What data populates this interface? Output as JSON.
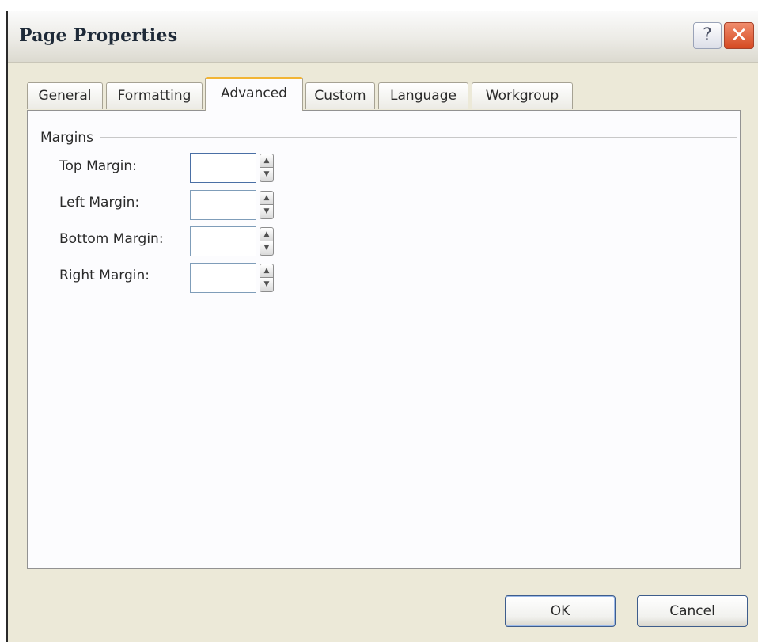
{
  "dialog": {
    "title": "Page Properties",
    "help_label": "?",
    "close_label": "✕"
  },
  "tabs": [
    {
      "label": "General",
      "active": false
    },
    {
      "label": "Formatting",
      "active": false
    },
    {
      "label": "Advanced",
      "active": true
    },
    {
      "label": "Custom",
      "active": false
    },
    {
      "label": "Language",
      "active": false
    },
    {
      "label": "Workgroup",
      "active": false
    }
  ],
  "margins": {
    "group_label": "Margins",
    "fields": [
      {
        "label": "Top Margin:",
        "value": ""
      },
      {
        "label": "Left Margin:",
        "value": ""
      },
      {
        "label": "Bottom Margin:",
        "value": ""
      },
      {
        "label": "Right Margin:",
        "value": ""
      }
    ]
  },
  "buttons": {
    "ok": "OK",
    "cancel": "Cancel"
  },
  "icons": {
    "help": "help-icon",
    "close": "close-icon",
    "spin_up": "arrow-up-icon",
    "spin_down": "arrow-down-icon"
  },
  "colors": {
    "active_tab_accent": "#f2b536",
    "close_button": "#d54a22"
  }
}
